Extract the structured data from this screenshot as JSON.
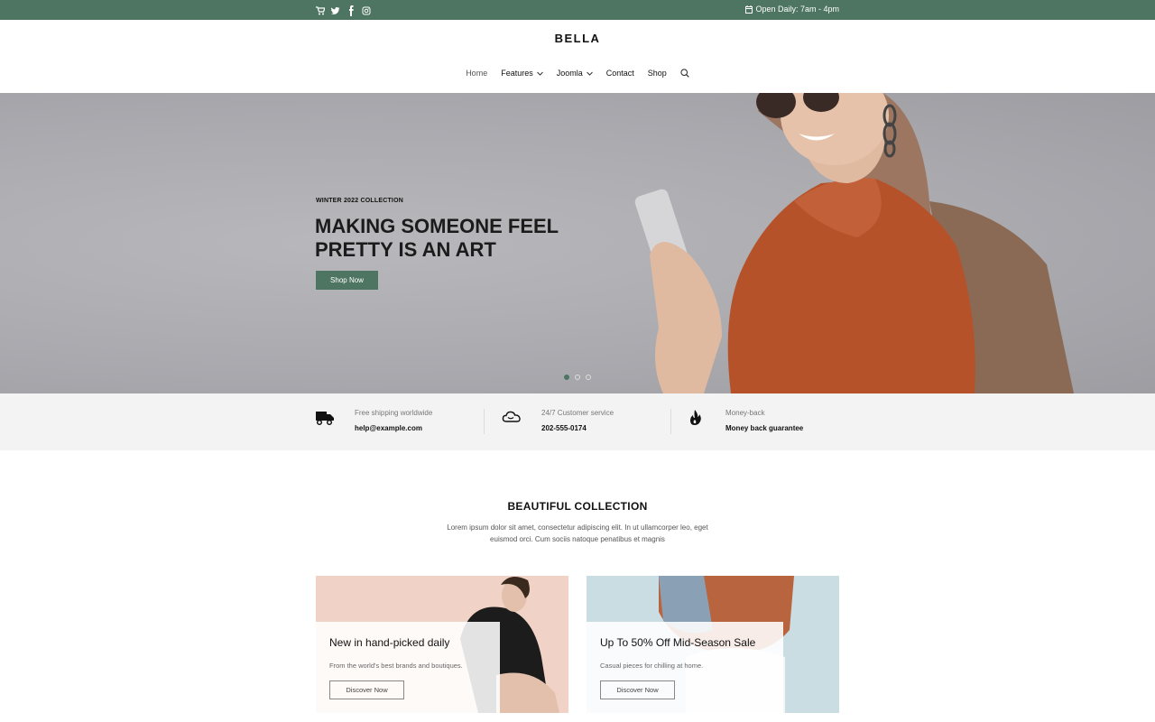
{
  "topbar": {
    "social_icons": [
      "cart-icon",
      "twitter-icon",
      "facebook-icon",
      "instagram-icon"
    ],
    "hours": "Open Daily: 7am - 4pm"
  },
  "header": {
    "brand": "BELLA",
    "nav": [
      {
        "label": "Home",
        "active": true
      },
      {
        "label": "Features",
        "dropdown": true
      },
      {
        "label": "Joomla",
        "dropdown": true
      },
      {
        "label": "Contact"
      },
      {
        "label": "Shop"
      }
    ]
  },
  "hero": {
    "eyebrow": "WINTER 2022 COLLECTION",
    "headline": "MAKING SOMEONE FEEL PRETTY IS AN ART",
    "cta": "Shop Now",
    "slides": 3,
    "active_slide": 1
  },
  "features": [
    {
      "icon": "truck-icon",
      "title": "Free shipping worldwide",
      "value": "help@example.com"
    },
    {
      "icon": "cloud-icon",
      "title": "24/7 Customer service",
      "value": "202-555-0174"
    },
    {
      "icon": "flame-icon",
      "title": "Money-back",
      "value": "Money back guarantee"
    }
  ],
  "collection": {
    "title": "BEAUTIFUL COLLECTION",
    "description": "Lorem ipsum dolor sit amet, consectetur adipiscing elit. In ut ullamcorper leo, eget euismod orci. Cum sociis natoque penatibus et magnis",
    "cards": [
      {
        "title": "New in hand-picked daily",
        "desc": "From the world's best brands and boutiques.",
        "button": "Discover Now"
      },
      {
        "title": "Up To 50% Off Mid-Season Sale",
        "desc": "Casual pieces for chilling at home.",
        "button": "Discover Now"
      }
    ]
  },
  "colors": {
    "accent": "#4e7561",
    "strip": "#f3f3f3",
    "card1": "#f0d2c6",
    "card2": "#c9dde2"
  }
}
